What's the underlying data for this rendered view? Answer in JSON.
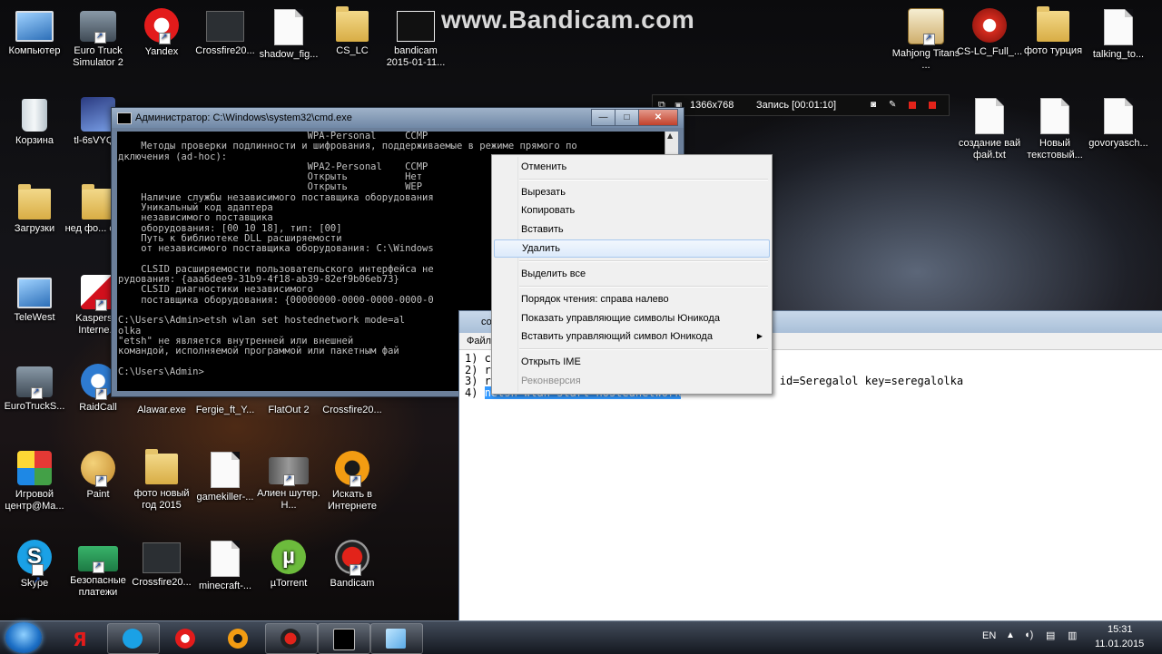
{
  "watermark": "www.Bandicam.com",
  "desktop_icons": [
    {
      "label": "Компьютер",
      "icon": "computer-icon"
    },
    {
      "label": "Euro Truck Simulator 2",
      "icon": "truck-icon"
    },
    {
      "label": "Yandex",
      "icon": "yandex-icon"
    },
    {
      "label": "Crossfire20...",
      "icon": "crossfire-icon"
    },
    {
      "label": "shadow_fig...",
      "icon": "document-icon"
    },
    {
      "label": "CS_LC",
      "icon": "folder-icon"
    },
    {
      "label": "bandicam 2015-01-11...",
      "icon": "video-file-icon"
    },
    {
      "label": "Mahjong Titans ...",
      "icon": "mahjong-icon"
    },
    {
      "label": "CS-LC_Full_...",
      "icon": "crossfire-logo-icon"
    },
    {
      "label": "фото турция",
      "icon": "folder-icon"
    },
    {
      "label": "talking_to...",
      "icon": "document-icon"
    },
    {
      "label": "Корзина",
      "icon": "recycle-bin-icon"
    },
    {
      "label": "tl-6sVYQ...",
      "icon": "image-file-icon"
    },
    {
      "label": "создание вай фай.txt",
      "icon": "text-file-icon"
    },
    {
      "label": "Новый текстовый...",
      "icon": "text-file-icon"
    },
    {
      "label": "govoryasch...",
      "icon": "document-icon"
    },
    {
      "label": "Загрузки",
      "icon": "downloads-folder-icon"
    },
    {
      "label": "нед фо... спид",
      "icon": "folder-icon"
    },
    {
      "label": "TeleWest",
      "icon": "network-icon"
    },
    {
      "label": "Kaspers... Interne...",
      "icon": "kaspersky-icon"
    },
    {
      "label": "EuroTruckS...",
      "icon": "truck-icon"
    },
    {
      "label": "RaidCall",
      "icon": "raidcall-icon"
    },
    {
      "label": "Alawar.exe",
      "icon": "exe-icon"
    },
    {
      "label": "Fergie_ft_Y...",
      "icon": "media-icon"
    },
    {
      "label": "FlatOut 2",
      "icon": "game-icon"
    },
    {
      "label": "Crossfire20...",
      "icon": "crossfire-icon"
    },
    {
      "label": "Игровой центр@Ma...",
      "icon": "game-center-icon"
    },
    {
      "label": "Paint",
      "icon": "paint-icon"
    },
    {
      "label": "фото новый год 2015",
      "icon": "folder-icon"
    },
    {
      "label": "gamekiller-...",
      "icon": "document-icon"
    },
    {
      "label": "Алиен шутер. Н...",
      "icon": "gun-icon"
    },
    {
      "label": "Искать в Интернете",
      "icon": "mail-search-icon"
    },
    {
      "label": "Skype",
      "icon": "skype-icon"
    },
    {
      "label": "Безопасные платежи",
      "icon": "payment-card-icon"
    },
    {
      "label": "Crossfire20...",
      "icon": "crossfire-icon"
    },
    {
      "label": "minecraft-...",
      "icon": "document-icon"
    },
    {
      "label": "µTorrent",
      "icon": "utorrent-icon"
    },
    {
      "label": "Bandicam",
      "icon": "bandicam-icon"
    }
  ],
  "cmd": {
    "title": "Администратор: C:\\Windows\\system32\\cmd.exe",
    "lines": [
      "                                 WPA-Personal     CCMP",
      "    Методы проверки подлинности и шифрования, поддерживаемые в режиме прямого по",
      "дключения (ad-hoc):",
      "                                 WPA2-Personal    CCMP",
      "                                 Открыть          Нет",
      "                                 Открыть          WEP",
      "    Наличие службы независимого поставщика оборудования",
      "    Уникальный код адаптера",
      "    независимого поставщика",
      "    оборудования: [00 10 18], тип: [00]",
      "    Путь к библиотеке DLL расширяемости",
      "    от независимого поставщика оборудования: C:\\Windows",
      "",
      "    CLSID расширяемости пользовательского интерфейса не",
      "рудования: {aaa6dee9-31b9-4f18-ab39-82ef9b06eb73}",
      "    CLSID диагностики независимого",
      "    поставщика оборудования: {00000000-0000-0000-0000-0",
      "",
      "C:\\Users\\Admin>etsh wlan set hostednetwork mode=al",
      "olka",
      "\"etsh\" не является внутренней или внешней",
      "командой, исполняемой программой или пакетным фай",
      "",
      "C:\\Users\\Admin>"
    ]
  },
  "notepad": {
    "title": "со...",
    "menu": "Файл",
    "lines": [
      "1) c",
      "2) r",
      "3) r",
      "4) "
    ],
    "line3_tail": "id=Seregalol key=seregalolka",
    "selected": "netsh wlan start hostednetwork"
  },
  "context_menu": {
    "items": [
      {
        "label": "Отменить",
        "disabled": false
      },
      {
        "label": "Вырезать",
        "disabled": false
      },
      {
        "label": "Копировать",
        "disabled": false
      },
      {
        "label": "Вставить",
        "disabled": false
      },
      {
        "label": "Удалить",
        "disabled": false,
        "highlighted": true
      },
      {
        "label": "Выделить все",
        "disabled": false
      },
      {
        "label": "Порядок чтения: справа налево",
        "disabled": false
      },
      {
        "label": "Показать управляющие символы Юникода",
        "disabled": false
      },
      {
        "label": "Вставить управляющий символ Юникода",
        "disabled": false,
        "submenu": true
      },
      {
        "label": "Открыть IME",
        "disabled": false
      },
      {
        "label": "Реконверсия",
        "disabled": true
      }
    ]
  },
  "bandicam_bar": {
    "resolution": "1366x768",
    "recording": "Запись [00:01:10]"
  },
  "taskbar": {
    "pinned": [
      "yandex-browser-icon",
      "skype-icon",
      "yandex-icon",
      "mail-agent-icon",
      "bandicam-icon",
      "cmd-icon",
      "notepad-icon"
    ],
    "language": "EN",
    "time": "15:31",
    "date": "11.01.2015"
  },
  "colors": {
    "selection": "#3399ff",
    "cmd_bg": "#000000",
    "cmd_text": "#c0c0c0",
    "bandicam_record": "#e2231a"
  }
}
